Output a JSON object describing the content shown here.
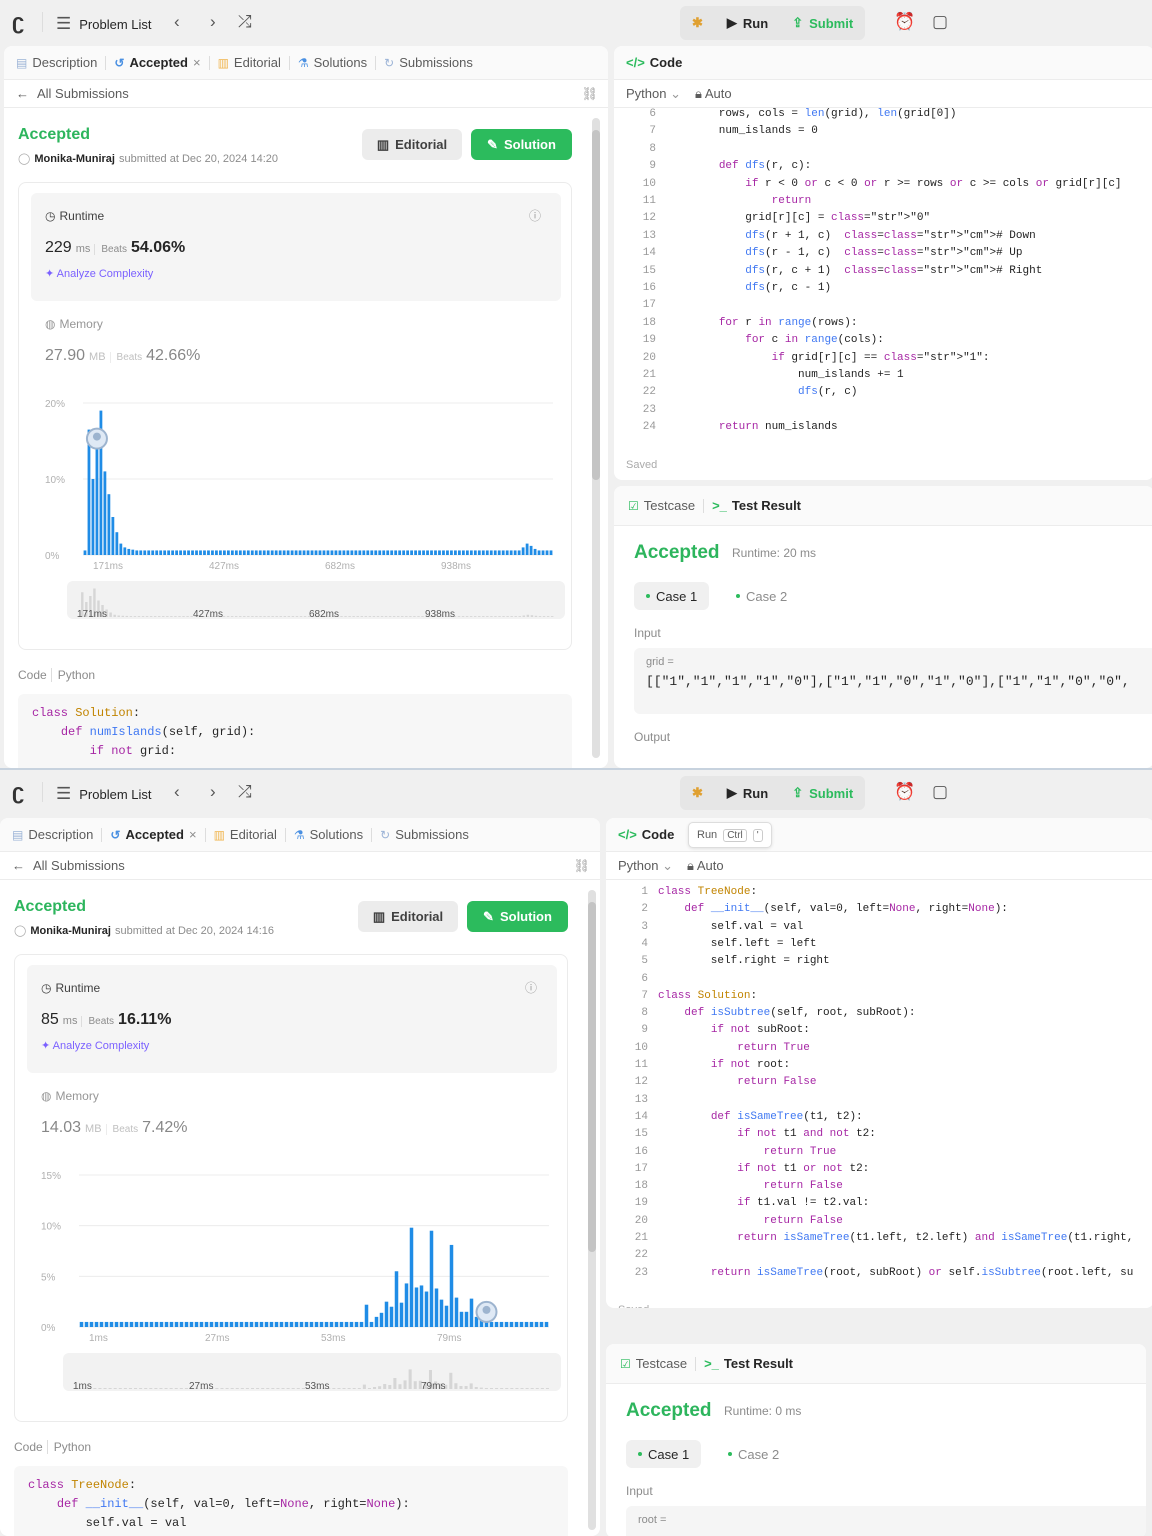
{
  "shots": [
    {
      "toolbar": {
        "problem_list": "Problem List",
        "run": "Run",
        "submit": "Submit"
      },
      "tabs": {
        "description": "Description",
        "accepted": "Accepted",
        "editorial": "Editorial",
        "solutions": "Solutions",
        "submissions": "Submissions"
      },
      "all_submissions": "All Submissions",
      "status": "Accepted",
      "user": "Monika-Muniraj",
      "submitted_at": "submitted at Dec 20, 2024 14:20",
      "editorial_btn": "Editorial",
      "solution_btn": "Solution",
      "runtime": {
        "label": "Runtime",
        "value": "229",
        "unit": "ms",
        "beats_label": "Beats",
        "beats": "54.06%",
        "analyze": "Analyze Complexity"
      },
      "memory": {
        "label": "Memory",
        "value": "27.90",
        "unit": "MB",
        "beats_label": "Beats",
        "beats": "42.66%"
      },
      "histogram": {
        "y_ticks": [
          "20%",
          "10%",
          "0%"
        ],
        "x_ticks": [
          "171ms",
          "427ms",
          "682ms",
          "938ms"
        ],
        "values": [
          0.6,
          16.5,
          10,
          14,
          19,
          11,
          8,
          5,
          3,
          1.5,
          1,
          0.8,
          0.7,
          0.6,
          0.6,
          0.6,
          0.6,
          0.6,
          0.6,
          0.6,
          0.6,
          0.6,
          0.6,
          0.6,
          0.6,
          0.6,
          0.6,
          0.6,
          0.6,
          0.6,
          0.6,
          0.6,
          0.6,
          0.6,
          0.6,
          0.6,
          0.6,
          0.6,
          0.6,
          0.6,
          0.6,
          0.6,
          0.6,
          0.6,
          0.6,
          0.6,
          0.6,
          0.6,
          0.6,
          0.6,
          0.6,
          0.6,
          0.6,
          0.6,
          0.6,
          0.6,
          0.6,
          0.6,
          0.6,
          0.6,
          0.6,
          0.6,
          0.6,
          0.6,
          0.6,
          0.6,
          0.6,
          0.6,
          0.6,
          0.6,
          0.6,
          0.6,
          0.6,
          0.6,
          0.6,
          0.6,
          0.6,
          0.6,
          0.6,
          0.6,
          0.6,
          0.6,
          0.6,
          0.6,
          0.6,
          0.6,
          0.6,
          0.6,
          0.6,
          0.6,
          0.6,
          0.6,
          0.6,
          0.6,
          0.6,
          0.6,
          0.6,
          0.6,
          0.6,
          0.6,
          0.6,
          0.6,
          0.6,
          0.6,
          0.6,
          0.6,
          0.6,
          0.6,
          0.6,
          0.6,
          1,
          1.5,
          1.2,
          0.8,
          0.6,
          0.6,
          0.6,
          0.6
        ],
        "y_max": 20,
        "marker_bar": 3
      },
      "code_label": "Code",
      "code_lang": "Python",
      "code_preview": [
        "class Solution:",
        "    def numIslands(self, grid):",
        "        if not grid:"
      ],
      "editor": {
        "tab": "Code",
        "lang": "Python",
        "auto": "Auto",
        "lines": [
          {
            "n": "6",
            "t": "        rows, cols = len(grid), len(grid[0])"
          },
          {
            "n": "7",
            "t": "        num_islands = 0"
          },
          {
            "n": "8",
            "t": ""
          },
          {
            "n": "9",
            "t": "        def dfs(r, c):"
          },
          {
            "n": "10",
            "t": "            if r < 0 or c < 0 or r >= rows or c >= cols or grid[r][c]"
          },
          {
            "n": "11",
            "t": "                return"
          },
          {
            "n": "12",
            "t": "            grid[r][c] = \"0\""
          },
          {
            "n": "13",
            "t": "            dfs(r + 1, c)  # Down"
          },
          {
            "n": "14",
            "t": "            dfs(r - 1, c)  # Up"
          },
          {
            "n": "15",
            "t": "            dfs(r, c + 1)  # Right"
          },
          {
            "n": "16",
            "t": "            dfs(r, c - 1)"
          },
          {
            "n": "17",
            "t": ""
          },
          {
            "n": "18",
            "t": "        for r in range(rows):"
          },
          {
            "n": "19",
            "t": "            for c in range(cols):"
          },
          {
            "n": "20",
            "t": "                if grid[r][c] == \"1\":"
          },
          {
            "n": "21",
            "t": "                    num_islands += 1"
          },
          {
            "n": "22",
            "t": "                    dfs(r, c)"
          },
          {
            "n": "23",
            "t": ""
          },
          {
            "n": "24",
            "t": "        return num_islands"
          }
        ],
        "saved": "Saved"
      },
      "result": {
        "testcase": "Testcase",
        "test_result": "Test Result",
        "status": "Accepted",
        "runtime": "Runtime: 20 ms",
        "case1": "Case 1",
        "case2": "Case 2",
        "input_label": "Input",
        "var": "grid =",
        "value": "[[\"1\",\"1\",\"1\",\"1\",\"0\"],[\"1\",\"1\",\"0\",\"1\",\"0\"],[\"1\",\"1\",\"0\",\"0\",",
        "output_label": "Output"
      }
    },
    {
      "toolbar": {
        "problem_list": "Problem List",
        "run": "Run",
        "submit": "Submit"
      },
      "tabs": {
        "description": "Description",
        "accepted": "Accepted",
        "editorial": "Editorial",
        "solutions": "Solutions",
        "submissions": "Submissions"
      },
      "all_submissions": "All Submissions",
      "status": "Accepted",
      "user": "Monika-Muniraj",
      "submitted_at": "submitted at Dec 20, 2024 14:16",
      "editorial_btn": "Editorial",
      "solution_btn": "Solution",
      "runtime": {
        "label": "Runtime",
        "value": "85",
        "unit": "ms",
        "beats_label": "Beats",
        "beats": "16.11%",
        "analyze": "Analyze Complexity"
      },
      "memory": {
        "label": "Memory",
        "value": "14.03",
        "unit": "MB",
        "beats_label": "Beats",
        "beats": "7.42%"
      },
      "histogram": {
        "y_ticks": [
          "15%",
          "10%",
          "5%",
          "0%"
        ],
        "x_ticks": [
          "1ms",
          "27ms",
          "53ms",
          "79ms"
        ],
        "values": [
          0.5,
          0.5,
          0.5,
          0.5,
          0.5,
          0.5,
          0.5,
          0.5,
          0.5,
          0.5,
          0.5,
          0.5,
          0.5,
          0.5,
          0.5,
          0.5,
          0.5,
          0.5,
          0.5,
          0.5,
          0.5,
          0.5,
          0.5,
          0.5,
          0.5,
          0.5,
          0.5,
          0.5,
          0.5,
          0.5,
          0.5,
          0.5,
          0.5,
          0.5,
          0.5,
          0.5,
          0.5,
          0.5,
          0.5,
          0.5,
          0.5,
          0.5,
          0.5,
          0.5,
          0.5,
          0.5,
          0.5,
          0.5,
          0.5,
          0.5,
          0.5,
          0.5,
          0.5,
          0.5,
          0.5,
          0.5,
          0.5,
          2.2,
          0.5,
          1,
          1.4,
          2.5,
          2,
          5.5,
          2.4,
          4.3,
          9.8,
          3.9,
          4.1,
          3.5,
          9.5,
          3.8,
          2.7,
          2.1,
          8.1,
          2.9,
          1.5,
          1.5,
          2.8,
          1,
          0.7,
          0.5,
          0.5,
          0.5,
          0.5,
          0.5,
          0.5,
          0.5,
          0.5,
          0.5,
          0.5,
          0.5,
          0.5,
          0.5
        ],
        "y_max": 15,
        "marker_bar": 81
      },
      "code_label": "Code",
      "code_lang": "Python",
      "code_preview": [
        "class TreeNode:",
        "    def __init__(self, val=0, left=None, right=None):",
        "        self.val = val"
      ],
      "editor": {
        "tab": "Code",
        "lang": "Python",
        "auto": "Auto",
        "run_hint": "Run",
        "ctrl": "Ctrl",
        "quote": "'",
        "lines": [
          {
            "n": "1",
            "t": "class TreeNode:"
          },
          {
            "n": "2",
            "t": "    def __init__(self, val=0, left=None, right=None):"
          },
          {
            "n": "3",
            "t": "        self.val = val"
          },
          {
            "n": "4",
            "t": "        self.left = left"
          },
          {
            "n": "5",
            "t": "        self.right = right"
          },
          {
            "n": "6",
            "t": ""
          },
          {
            "n": "7",
            "t": "class Solution:"
          },
          {
            "n": "8",
            "t": "    def isSubtree(self, root, subRoot):"
          },
          {
            "n": "9",
            "t": "        if not subRoot:"
          },
          {
            "n": "10",
            "t": "            return True"
          },
          {
            "n": "11",
            "t": "        if not root:"
          },
          {
            "n": "12",
            "t": "            return False"
          },
          {
            "n": "13",
            "t": ""
          },
          {
            "n": "14",
            "t": "        def isSameTree(t1, t2):"
          },
          {
            "n": "15",
            "t": "            if not t1 and not t2:"
          },
          {
            "n": "16",
            "t": "                return True"
          },
          {
            "n": "17",
            "t": "            if not t1 or not t2:"
          },
          {
            "n": "18",
            "t": "                return False"
          },
          {
            "n": "19",
            "t": "            if t1.val != t2.val:"
          },
          {
            "n": "20",
            "t": "                return False"
          },
          {
            "n": "21",
            "t": "            return isSameTree(t1.left, t2.left) and isSameTree(t1.right,"
          },
          {
            "n": "22",
            "t": ""
          },
          {
            "n": "23",
            "t": "        return isSameTree(root, subRoot) or self.isSubtree(root.left, su"
          }
        ],
        "saved": "Saved"
      },
      "result": {
        "testcase": "Testcase",
        "test_result": "Test Result",
        "status": "Accepted",
        "runtime": "Runtime: 0 ms",
        "case1": "Case 1",
        "case2": "Case 2",
        "input_label": "Input",
        "var": "root =",
        "value": "",
        "output_label": ""
      }
    }
  ],
  "colors": {
    "accent_green": "#2cbb5d",
    "bar_blue": "#1f8ce6"
  }
}
